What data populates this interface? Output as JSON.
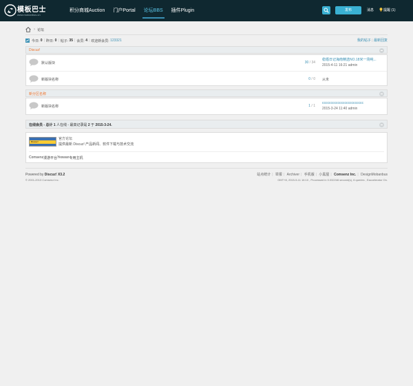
{
  "header": {
    "logo_title": "模板巴士",
    "logo_url": "www.mobanbus.cn",
    "nav": [
      "积分商城Auction",
      "门户Portal",
      "论坛BBS",
      "插件Plugin"
    ],
    "post_button": "发布",
    "messages": "消息",
    "reminders": "提醒 (1)",
    "colors": {
      "bar": "#0f2830",
      "accent": "#3ab0d2"
    }
  },
  "breadcrumb": {
    "current": "论坛"
  },
  "stats": {
    "today_label": "今日:",
    "today": "0",
    "yesterday_label": "昨日:",
    "yesterday": "0",
    "posts_label": "帖子:",
    "posts": "35",
    "members_label": "会员:",
    "members": "4",
    "newest_label": "欢迎新会员:",
    "newest_member": "123321",
    "my_posts": "我的帖子",
    "latest_replies": "最新回复"
  },
  "categories": [
    {
      "title": "Discuz!",
      "forums": [
        {
          "name": "默认版块",
          "threads": "30",
          "posts": "34",
          "last_title": "稳婚日记海南精选NO.18米一场纯...",
          "last_meta": "2015-4-11 16:21 admin"
        },
        {
          "name": "新版块名称",
          "threads": "0",
          "posts": "0",
          "last_title": "从未",
          "last_meta": ""
        }
      ]
    },
    {
      "title": "新分区名称",
      "forums": [
        {
          "name": "新版块名称",
          "threads": "1",
          "posts": "1",
          "last_title": "cccccccccccccccccccccccc",
          "last_meta": "2015-3-24 11:40 admin"
        }
      ]
    }
  ],
  "online": {
    "text_prefix": "在线会员 - 总计",
    "total": "1",
    "text_mid": "人在线 - 最高记录是",
    "max": "2",
    "text_on": "于",
    "date": "2015-3-24."
  },
  "partner": {
    "logo_text": "Discuz!",
    "name": "官方论坛",
    "description": "提供最新 Discuz! 产品新闻、软件下载与技术交流",
    "links": [
      "Comsenz",
      "漫游平台",
      "Yeswan",
      "专用主机"
    ]
  },
  "footer": {
    "powered": "Powered by",
    "product": "Discuz! X3.2",
    "copyright": "© 2001-2013 Comsenz Inc.",
    "links": [
      "站点统计",
      "举报",
      "Archiver",
      "手机版",
      "小黑屋"
    ],
    "company": "Comsenz Inc.",
    "design": "Design",
    "designer": "Mobanbus",
    "debug": "GMT+8, 2015-5-11 16:10 , Processed in 0.032246 second(s), 6 queries , Eaccelerator On."
  }
}
